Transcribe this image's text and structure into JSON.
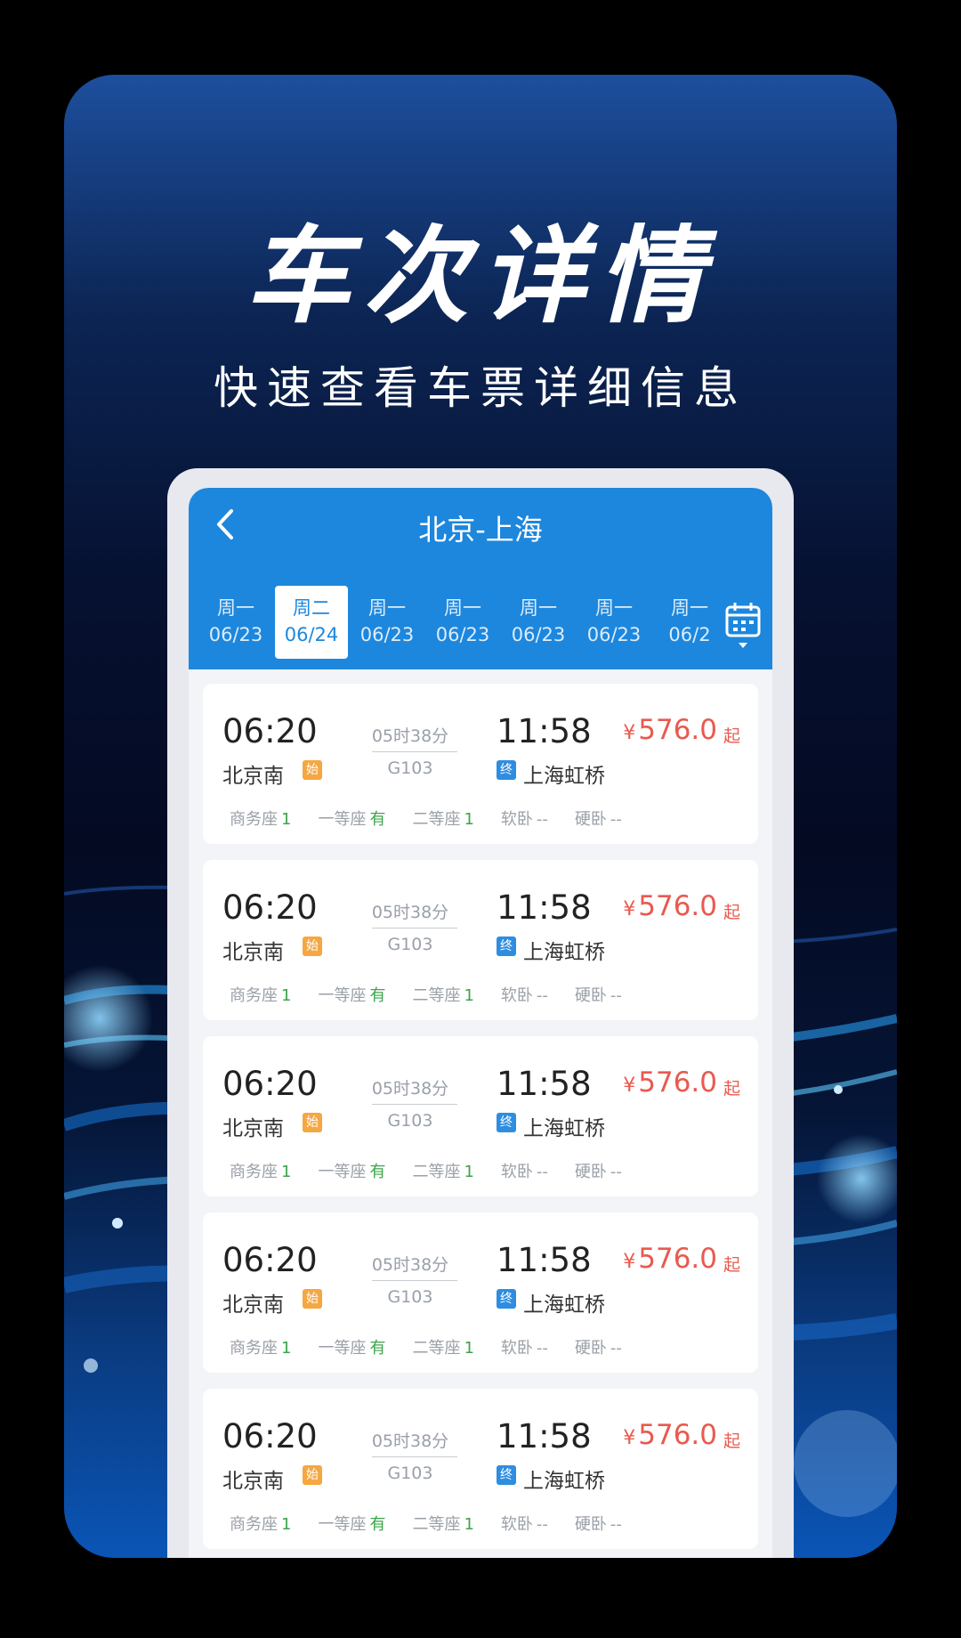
{
  "poster": {
    "headline": "车次详情",
    "subline": "快速查看车票详细信息"
  },
  "appbar": {
    "title": "北京-上海",
    "back_icon": "chevron-left-icon",
    "calendar_icon": "calendar-icon"
  },
  "dates": [
    {
      "weekday": "周一",
      "date": "06/23",
      "active": false
    },
    {
      "weekday": "周二",
      "date": "06/24",
      "active": true
    },
    {
      "weekday": "周一",
      "date": "06/23",
      "active": false
    },
    {
      "weekday": "周一",
      "date": "06/23",
      "active": false
    },
    {
      "weekday": "周一",
      "date": "06/23",
      "active": false
    },
    {
      "weekday": "周一",
      "date": "06/23",
      "active": false
    },
    {
      "weekday": "周一",
      "date": "06/2",
      "active": false
    }
  ],
  "trains": [
    {
      "dep_time": "06:20",
      "dep_station": "北京南",
      "start_badge": "始",
      "duration": "05时38分",
      "train_no": "G103",
      "arr_time": "11:58",
      "end_badge": "终",
      "arr_station": "上海虹桥",
      "price": "576.0",
      "currency": "¥",
      "price_suffix": "起",
      "seats": [
        {
          "name": "商务座",
          "value": "1"
        },
        {
          "name": "一等座",
          "value": "有"
        },
        {
          "name": "二等座",
          "value": "1"
        },
        {
          "name": "软卧",
          "value": "--"
        },
        {
          "name": "硬卧",
          "value": "--"
        }
      ]
    },
    {
      "dep_time": "06:20",
      "dep_station": "北京南",
      "start_badge": "始",
      "duration": "05时38分",
      "train_no": "G103",
      "arr_time": "11:58",
      "end_badge": "终",
      "arr_station": "上海虹桥",
      "price": "576.0",
      "currency": "¥",
      "price_suffix": "起",
      "seats": [
        {
          "name": "商务座",
          "value": "1"
        },
        {
          "name": "一等座",
          "value": "有"
        },
        {
          "name": "二等座",
          "value": "1"
        },
        {
          "name": "软卧",
          "value": "--"
        },
        {
          "name": "硬卧",
          "value": "--"
        }
      ]
    },
    {
      "dep_time": "06:20",
      "dep_station": "北京南",
      "start_badge": "始",
      "duration": "05时38分",
      "train_no": "G103",
      "arr_time": "11:58",
      "end_badge": "终",
      "arr_station": "上海虹桥",
      "price": "576.0",
      "currency": "¥",
      "price_suffix": "起",
      "seats": [
        {
          "name": "商务座",
          "value": "1"
        },
        {
          "name": "一等座",
          "value": "有"
        },
        {
          "name": "二等座",
          "value": "1"
        },
        {
          "name": "软卧",
          "value": "--"
        },
        {
          "name": "硬卧",
          "value": "--"
        }
      ]
    },
    {
      "dep_time": "06:20",
      "dep_station": "北京南",
      "start_badge": "始",
      "duration": "05时38分",
      "train_no": "G103",
      "arr_time": "11:58",
      "end_badge": "终",
      "arr_station": "上海虹桥",
      "price": "576.0",
      "currency": "¥",
      "price_suffix": "起",
      "seats": [
        {
          "name": "商务座",
          "value": "1"
        },
        {
          "name": "一等座",
          "value": "有"
        },
        {
          "name": "二等座",
          "value": "1"
        },
        {
          "name": "软卧",
          "value": "--"
        },
        {
          "name": "硬卧",
          "value": "--"
        }
      ]
    },
    {
      "dep_time": "06:20",
      "dep_station": "北京南",
      "start_badge": "始",
      "duration": "05时38分",
      "train_no": "G103",
      "arr_time": "11:58",
      "end_badge": "终",
      "arr_station": "上海虹桥",
      "price": "576.0",
      "currency": "¥",
      "price_suffix": "起",
      "seats": [
        {
          "name": "商务座",
          "value": "1"
        },
        {
          "name": "一等座",
          "value": "有"
        },
        {
          "name": "二等座",
          "value": "1"
        },
        {
          "name": "软卧",
          "value": "--"
        },
        {
          "name": "硬卧",
          "value": "--"
        }
      ]
    }
  ],
  "colors": {
    "primary": "#1d87dd",
    "price": "#e85a4f",
    "available": "#3ba54a",
    "start_badge": "#f5a742"
  }
}
